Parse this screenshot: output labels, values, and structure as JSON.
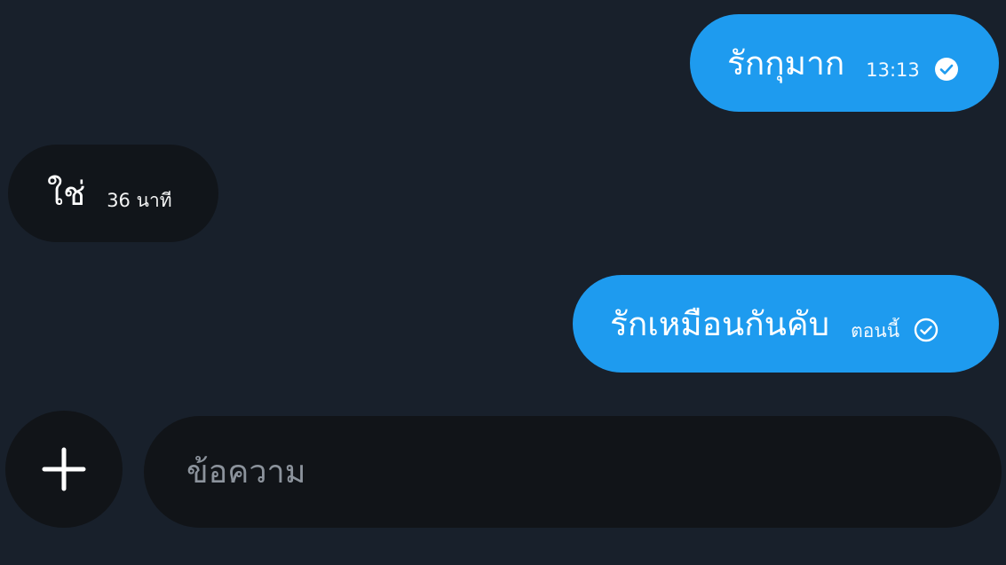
{
  "messages": [
    {
      "direction": "out",
      "text": "รักกุมาก",
      "time": "13:13",
      "status": "read-check-filled-icon"
    },
    {
      "direction": "in",
      "text": "ใช่",
      "time": "36 นาที"
    },
    {
      "direction": "out",
      "text": "รักเหมือนกันคับ",
      "time": "ตอนนี้",
      "status": "sent-check-outline-icon"
    }
  ],
  "composer": {
    "placeholder": "ข้อความ",
    "value": "",
    "add_icon": "plus-icon"
  },
  "colors": {
    "background": "#18202b",
    "outgoing_bubble": "#1e9bef",
    "incoming_bubble": "#11151a",
    "composer": "#111418",
    "placeholder": "#8c939c"
  }
}
